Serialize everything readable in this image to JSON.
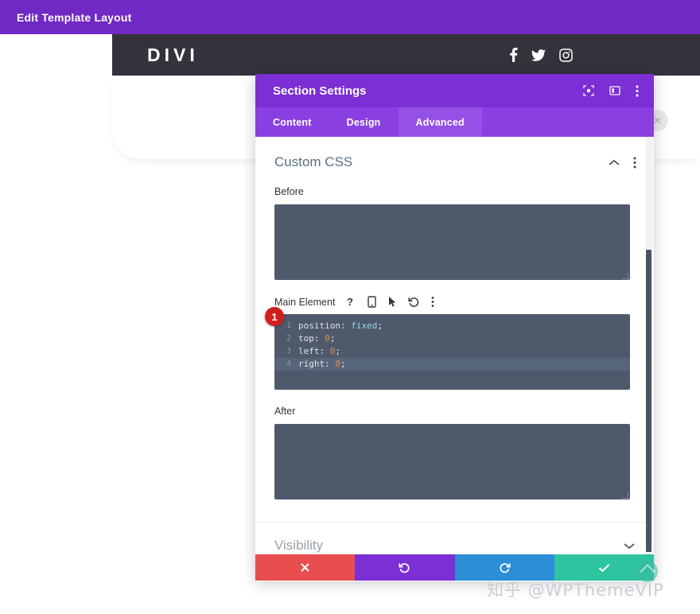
{
  "admin_bar": {
    "title": "Edit Template Layout",
    "bg": "#7029c4"
  },
  "site_header": {
    "logo": "DIVI",
    "bg": "#33333b",
    "social": [
      {
        "name": "facebook-icon",
        "label": "Facebook"
      },
      {
        "name": "twitter-icon",
        "label": "Twitter"
      },
      {
        "name": "instagram-icon",
        "label": "Instagram"
      }
    ]
  },
  "modal": {
    "title": "Section Settings",
    "header_bg": "#7b2fd4",
    "header_icons": [
      {
        "name": "expand-icon",
        "label": "Expand"
      },
      {
        "name": "layout-panel-icon",
        "label": "Layout"
      },
      {
        "name": "more-vertical-icon",
        "label": "More options"
      }
    ],
    "tabs": [
      {
        "label": "Content",
        "active": false
      },
      {
        "label": "Design",
        "active": false
      },
      {
        "label": "Advanced",
        "active": true
      }
    ],
    "sections": {
      "custom_css": {
        "title": "Custom CSS",
        "collapse_icon": "chevron-up-icon",
        "more_icon": "more-vertical-icon",
        "fields": {
          "before": {
            "label": "Before",
            "value": ""
          },
          "main_element": {
            "label": "Main Element",
            "tool_icons": [
              {
                "name": "help-icon",
                "glyph": "?"
              },
              {
                "name": "mobile-icon",
                "glyph": "mobile"
              },
              {
                "name": "cursor-icon",
                "glyph": "cursor"
              },
              {
                "name": "reset-icon",
                "glyph": "undo"
              },
              {
                "name": "more-vertical-icon",
                "glyph": "dots"
              }
            ],
            "badge": "1",
            "badge_color": "#d11f1f",
            "code_lines": [
              {
                "num": "1",
                "property": "position",
                "value": "fixed",
                "value_type": "keyword",
                "highlighted": false
              },
              {
                "num": "2",
                "property": "top",
                "value": "0",
                "value_type": "number",
                "highlighted": false
              },
              {
                "num": "3",
                "property": "left",
                "value": "0",
                "value_type": "number",
                "highlighted": false
              },
              {
                "num": "4",
                "property": "right",
                "value": "0",
                "value_type": "number",
                "highlighted": true
              }
            ]
          },
          "after": {
            "label": "After",
            "value": ""
          }
        }
      },
      "visibility": {
        "title": "Visibility",
        "expand_icon": "chevron-down-icon"
      }
    }
  },
  "action_bar": {
    "buttons": [
      {
        "name": "cancel-button",
        "icon": "close-icon",
        "color": "#e84e4e"
      },
      {
        "name": "undo-button",
        "icon": "undo-icon",
        "color": "#7b2fd4"
      },
      {
        "name": "redo-button",
        "icon": "redo-icon",
        "color": "#2b8ed6"
      },
      {
        "name": "save-button",
        "icon": "check-icon",
        "color": "#2ec4a0"
      }
    ]
  },
  "watermark": {
    "text": "知乎 @WPThemeVIP"
  }
}
